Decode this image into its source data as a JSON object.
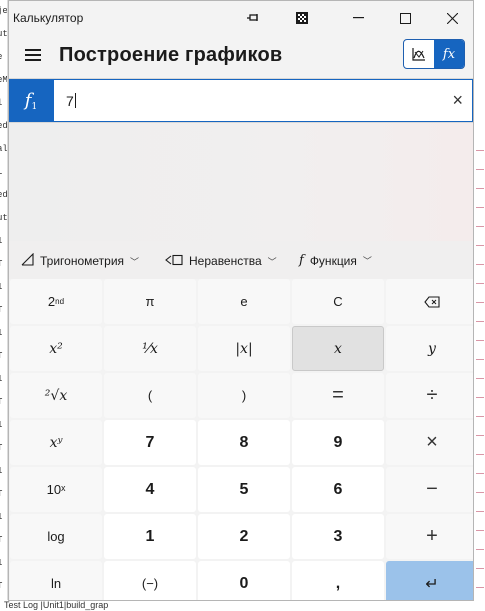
{
  "window": {
    "title": "Калькулятор",
    "buttons": [
      "pin-icon",
      "compact-overlay-icon",
      "minimize-icon",
      "maximize-icon",
      "close-icon"
    ]
  },
  "header": {
    "title": "Построение графиков",
    "mode_icons": [
      "graph-icon",
      "function-icon"
    ],
    "function_mode_label": "fx"
  },
  "function_row": {
    "label": "f",
    "index": "1",
    "value": "7",
    "clear_icon": "×"
  },
  "toolbar": {
    "trig_label": "Тригонометрия",
    "inequalities_label": "Неравенства",
    "function_label": "Функция"
  },
  "keypad": {
    "second": "2nd",
    "pi": "π",
    "e": "e",
    "clear": "C",
    "backspace": "⌫",
    "x_squared": "x²",
    "reciprocal": "¹⁄x",
    "abs": "|x|",
    "x": "x",
    "y": "y",
    "cube_root": "²√x",
    "lparen": "(",
    "rparen": ")",
    "equals": "=",
    "divide": "÷",
    "x_pow_y": "xʸ",
    "seven": "7",
    "eight": "8",
    "nine": "9",
    "multiply": "×",
    "ten_pow_x": "10ˣ",
    "four": "4",
    "five": "5",
    "six": "6",
    "minus": "−",
    "log": "log",
    "one": "1",
    "two": "2",
    "three": "3",
    "plus": "+",
    "ln": "ln",
    "negate": "(−)",
    "zero": "0",
    "comma": ",",
    "enter": "↵"
  },
  "background": {
    "bottom_text": "Test Log |Unit1|build_grap",
    "left_fragments": [
      "je",
      "ut",
      "e",
      "eM",
      "l",
      "ed",
      "al",
      "L",
      "ed",
      "ut",
      "1",
      "T",
      "1",
      "T",
      "1",
      "T",
      "1",
      "T",
      "1",
      "T",
      "1",
      "T",
      "1",
      "T",
      "1",
      "T"
    ]
  }
}
